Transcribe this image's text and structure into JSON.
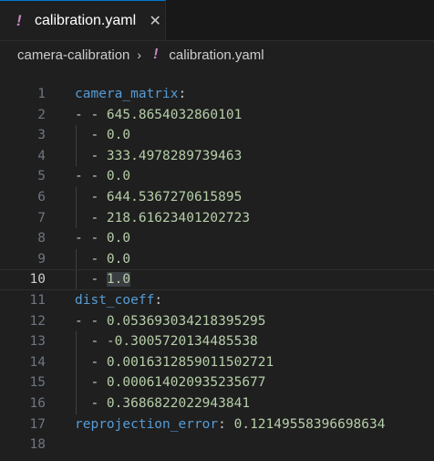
{
  "tab": {
    "icon": "!",
    "label": "calibration.yaml",
    "close": "✕"
  },
  "breadcrumb": {
    "folder": "camera-calibration",
    "separator": "›",
    "icon": "!",
    "file": "calibration.yaml"
  },
  "editor": {
    "current_line": 10,
    "lines": [
      {
        "n": "1",
        "key": "camera_matrix",
        "colon": ":"
      },
      {
        "n": "2",
        "prefix": "- - ",
        "value": "645.8654032860101"
      },
      {
        "n": "3",
        "prefix": "  - ",
        "value": "0.0"
      },
      {
        "n": "4",
        "prefix": "  - ",
        "value": "333.4978289739463"
      },
      {
        "n": "5",
        "prefix": "- - ",
        "value": "0.0"
      },
      {
        "n": "6",
        "prefix": "  - ",
        "value": "644.5367270615895"
      },
      {
        "n": "7",
        "prefix": "  - ",
        "value": "218.61623401202723"
      },
      {
        "n": "8",
        "prefix": "- - ",
        "value": "0.0"
      },
      {
        "n": "9",
        "prefix": "  - ",
        "value": "0.0"
      },
      {
        "n": "10",
        "prefix": "  - ",
        "value": "1.0"
      },
      {
        "n": "11",
        "key": "dist_coeff",
        "colon": ":"
      },
      {
        "n": "12",
        "prefix": "- - ",
        "value": "0.053693034218395295"
      },
      {
        "n": "13",
        "prefix": "  - ",
        "value": "-0.3005720134485538"
      },
      {
        "n": "14",
        "prefix": "  - ",
        "value": "0.0016312859011502721"
      },
      {
        "n": "15",
        "prefix": "  - ",
        "value": "0.000614020935235677"
      },
      {
        "n": "16",
        "prefix": "  - ",
        "value": "0.3686822022943841"
      },
      {
        "n": "17",
        "key": "reprojection_error",
        "colon": ": ",
        "value": "0.12149558396698634"
      },
      {
        "n": "18"
      }
    ]
  }
}
